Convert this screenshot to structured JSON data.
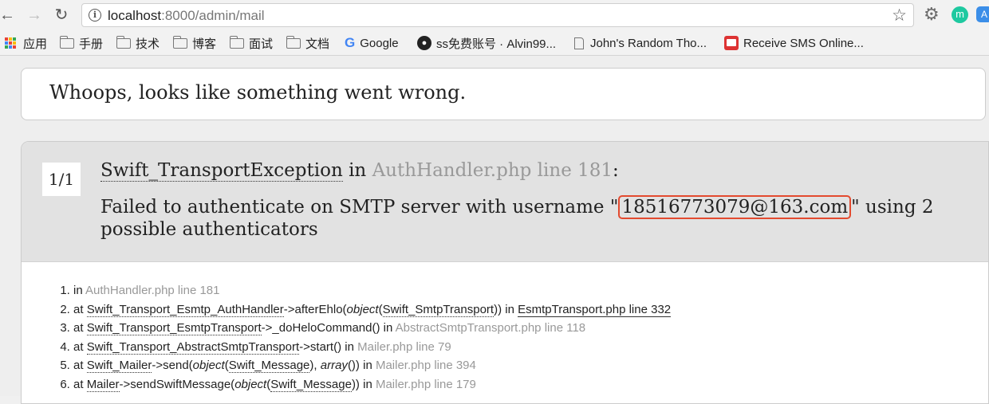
{
  "browser": {
    "url_host": "localhost",
    "url_rest": ":8000/admin/mail"
  },
  "bookmarks": [
    {
      "label": "应用",
      "icon": "apps-grid-icon"
    },
    {
      "label": "手册",
      "icon": "folder-icon"
    },
    {
      "label": "技术",
      "icon": "folder-icon"
    },
    {
      "label": "博客",
      "icon": "folder-icon"
    },
    {
      "label": "面试",
      "icon": "folder-icon"
    },
    {
      "label": "文档",
      "icon": "folder-icon"
    },
    {
      "label": "Google",
      "icon": "google-icon"
    },
    {
      "label": "ss免费账号 · Alvin99...",
      "icon": "github-icon"
    },
    {
      "label": "John's Random Tho...",
      "icon": "document-icon"
    },
    {
      "label": "Receive SMS Online...",
      "icon": "sms-icon"
    }
  ],
  "page": {
    "whoops": "Whoops, looks like something went wrong.",
    "counter": "1/1",
    "exception": {
      "class": "Swift_TransportException",
      "in_word": "in",
      "location": "AuthHandler.php line 181",
      "colon": ":",
      "message_prefix": "Failed to authenticate on SMTP server with username \"",
      "username": "18516773079@163.com",
      "message_suffix": "\" using 2 possible authenticators"
    },
    "trace": [
      {
        "prefix": "in ",
        "file": "AuthHandler.php line 181"
      },
      {
        "prefix": "at ",
        "cls": "Swift_Transport_Esmtp_AuthHandler",
        "call": "->afterEhlo(",
        "arg_type": "object",
        "arg_cls": "Swift_SmtpTransport",
        "arg_close": "))",
        "in": " in ",
        "file": "EsmtpTransport.php line 332"
      },
      {
        "prefix": "at ",
        "cls": "Swift_Transport_EsmtpTransport",
        "call": "->_doHeloCommand()",
        "in": " in ",
        "file": "AbstractSmtpTransport.php line 118"
      },
      {
        "prefix": "at ",
        "cls": "Swift_Transport_AbstractSmtpTransport",
        "call": "->start()",
        "in": " in ",
        "file": "Mailer.php line 79"
      },
      {
        "prefix": "at ",
        "cls": "Swift_Mailer",
        "call": "->send(",
        "arg_type": "object",
        "arg_cls": "Swift_Message",
        "arg_mid": "), ",
        "arg2_type": "array",
        "arg2_close": "())",
        "in": " in ",
        "file": "Mailer.php line 394"
      },
      {
        "prefix": "at ",
        "cls": "Mailer",
        "call": "->sendSwiftMessage(",
        "arg_type": "object",
        "arg_cls": "Swift_Message",
        "arg_close": "))",
        "in": " in ",
        "file": "Mailer.php line 179"
      }
    ]
  },
  "colors": {
    "highlight_border": "#e34a2f",
    "header_bg": "#e2e2e2",
    "muted_text": "#999999"
  }
}
